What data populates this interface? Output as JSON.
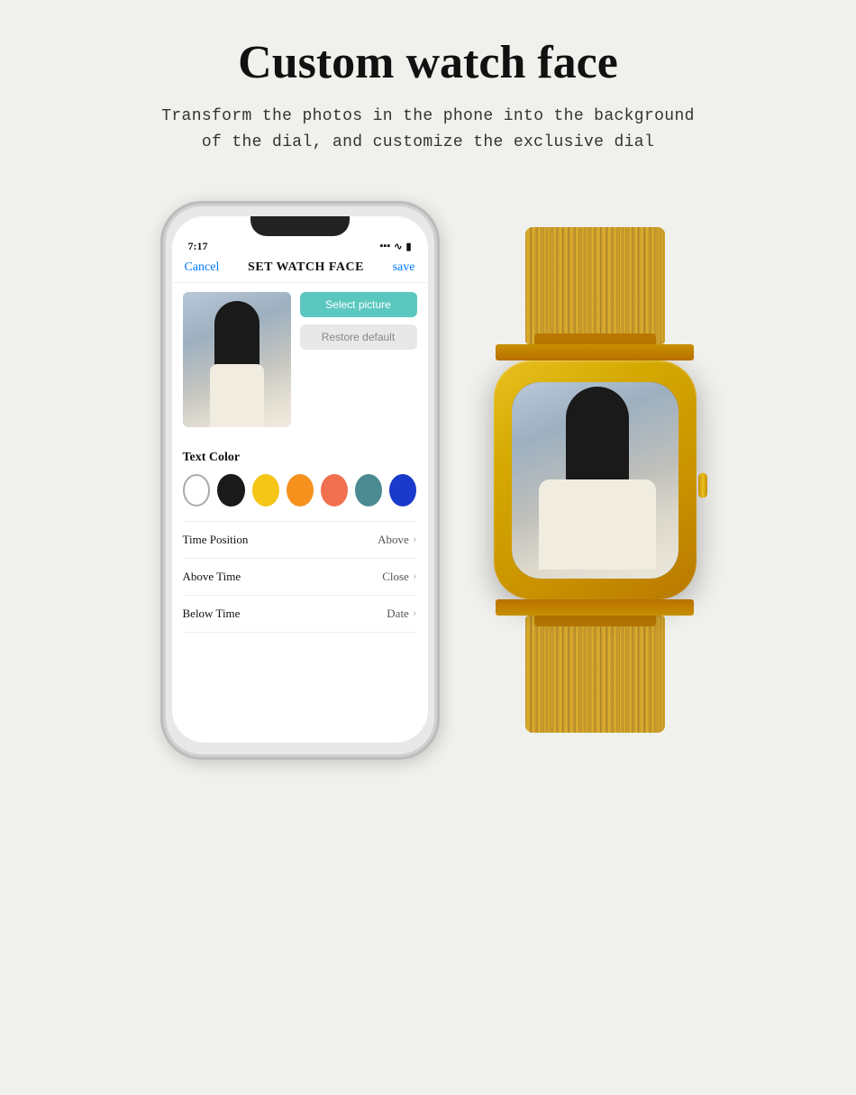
{
  "page": {
    "title": "Custom watch face",
    "subtitle_line1": "Transform the photos in the phone into the background",
    "subtitle_line2": "of the dial, and customize the exclusive dial"
  },
  "phone": {
    "status_time": "7:17",
    "cancel_label": "Cancel",
    "screen_title": "SET WATCH FACE",
    "save_label": "save",
    "select_picture_label": "Select picture",
    "restore_default_label": "Restore default",
    "text_color_label": "Text Color",
    "colors": [
      {
        "name": "white",
        "hex": "#ffffff",
        "selected": true
      },
      {
        "name": "black",
        "hex": "#1a1a1a",
        "selected": false
      },
      {
        "name": "yellow",
        "hex": "#f5c518",
        "selected": false
      },
      {
        "name": "orange",
        "hex": "#f5921e",
        "selected": false
      },
      {
        "name": "peach",
        "hex": "#f07050",
        "selected": false
      },
      {
        "name": "teal",
        "hex": "#4a8a90",
        "selected": false
      },
      {
        "name": "blue",
        "hex": "#1a3acc",
        "selected": false
      }
    ],
    "settings": [
      {
        "label": "Time Position",
        "value": "Above"
      },
      {
        "label": "Above Time",
        "value": "Close"
      },
      {
        "label": "Below Time",
        "value": "Date"
      }
    ]
  }
}
